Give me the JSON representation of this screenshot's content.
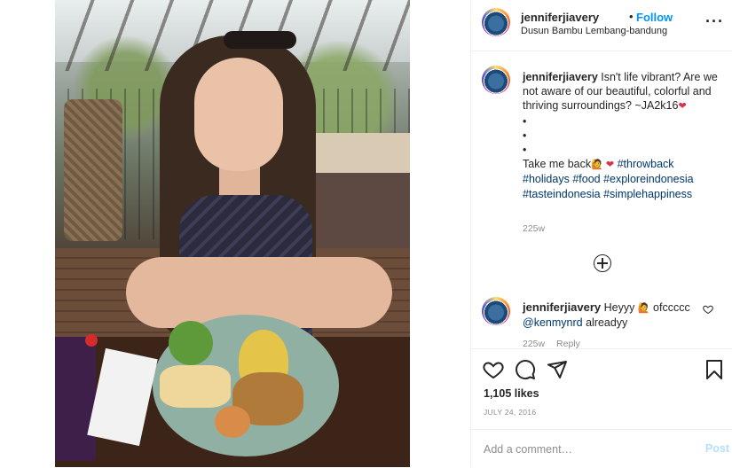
{
  "post": {
    "username": "jenniferjiavery",
    "follow_label": "Follow",
    "follow_dot": "•",
    "location": "Dusun Bambu Lembang-bandung",
    "more_label": "···"
  },
  "caption": {
    "username": "jenniferjiavery",
    "lines": [
      "Isn't life vibrant? Are we not aware of our beautiful, colorful and thriving surroundings? ~JA2k16",
      "•",
      "•",
      "•",
      "Take me back"
    ],
    "emoji_after_signature": "❤",
    "emoji_after_back": "🙋 ❤",
    "hashtags": [
      "#throwback",
      "#holidays",
      "#food",
      "#exploreindonesia",
      "#tasteindonesia",
      "#simplehappiness"
    ],
    "timestamp": "225w"
  },
  "comment": {
    "username": "jenniferjiavery",
    "text_before": "Heyyy",
    "emoji": "🙋",
    "text_after": "ofccccc",
    "mention": "@kenmynrd",
    "text_end": "alreadyy",
    "timestamp": "225w",
    "reply_label": "Reply"
  },
  "actions": {
    "likes": "1,105 likes",
    "date": "JULY 24, 2016"
  },
  "add_comment": {
    "placeholder": "Add a comment…",
    "post_label": "Post"
  },
  "colors": {
    "link": "#0095f6",
    "hashtag": "#00376b",
    "muted": "#8e8e8e",
    "heart": "#ed4956"
  },
  "icons": [
    "heart-icon",
    "comment-icon",
    "share-icon",
    "bookmark-icon",
    "add-circle-icon",
    "more-icon"
  ]
}
